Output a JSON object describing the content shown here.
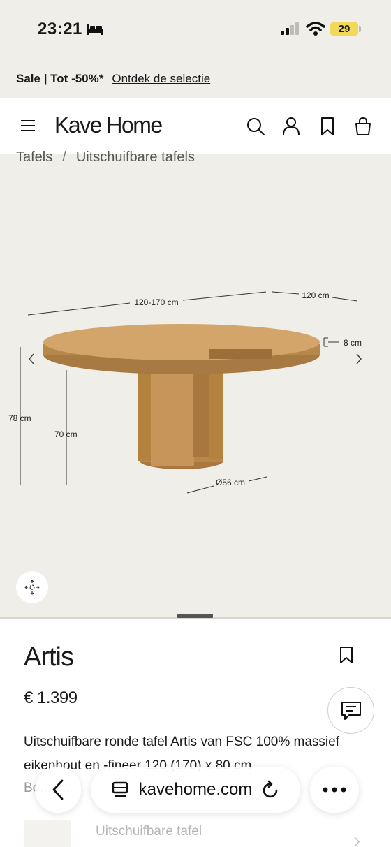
{
  "status": {
    "time": "23:21",
    "battery": "29"
  },
  "promo": {
    "sale": "Sale | Tot -50%*",
    "link": "Ontdek de selectie"
  },
  "header": {
    "logo": "Kave Home"
  },
  "breadcrumb": {
    "items": [
      "Tafels",
      "/",
      "Uitschuifbare tafels"
    ]
  },
  "diagram": {
    "width_label": "120-170 cm",
    "depth_label": "120 cm",
    "top_thickness_label": "8 cm",
    "total_height_label": "78 cm",
    "leg_height_label": "70 cm",
    "base_diameter_label": "Ø56 cm"
  },
  "product": {
    "title": "Artis",
    "price": "€ 1.399",
    "description": "Uitschuifbare ronde tafel Artis van FSC 100% massief eikenhout en -fineer 120 (170) x 80 cm",
    "more_link": "Be... e...",
    "variant_label": "Uitschuifbare tafel"
  },
  "browser": {
    "url": "kavehome.com"
  },
  "colors": {
    "background": "#efeee9",
    "wood": "#c9995f",
    "battery": "#f2d95a"
  }
}
